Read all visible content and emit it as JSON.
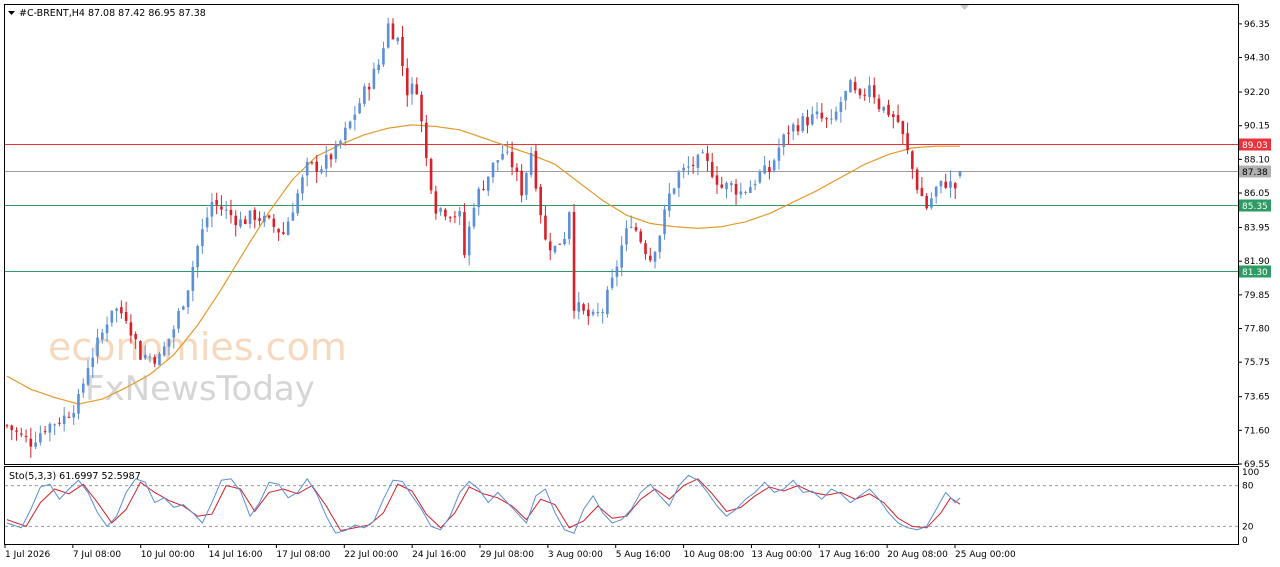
{
  "chart_data": {
    "type": "candlestick",
    "header": "#C-BRENT,H4  87.08 87.42 86.95 87.38",
    "symbol": "#C-BRENT",
    "timeframe": "H4",
    "ohlc": {
      "open": 87.08,
      "high": 87.42,
      "low": 86.95,
      "close": 87.38
    },
    "y_ticks": [
      "96.35",
      "94.30",
      "92.20",
      "90.15",
      "88.10",
      "86.05",
      "83.95",
      "81.90",
      "79.85",
      "77.80",
      "75.75",
      "73.65",
      "71.60",
      "69.55"
    ],
    "ylim": [
      69.55,
      97.5
    ],
    "x_ticks": [
      "1 Jul 2026",
      "7 Jul 08:00",
      "10 Jul 00:00",
      "14 Jul 16:00",
      "17 Jul 08:00",
      "22 Jul 00:00",
      "24 Jul 16:00",
      "29 Jul 08:00",
      "3 Aug 00:00",
      "5 Aug 16:00",
      "10 Aug 08:00",
      "13 Aug 00:00",
      "17 Aug 16:00",
      "20 Aug 08:00",
      "25 Aug 00:00"
    ],
    "price_anchors": [
      [
        0,
        71.9
      ],
      [
        3,
        71.2
      ],
      [
        5,
        70.9
      ],
      [
        8,
        71.8
      ],
      [
        12,
        72.4
      ],
      [
        15,
        73.4
      ],
      [
        17,
        75.6
      ],
      [
        20,
        77.5
      ],
      [
        22,
        79.1
      ],
      [
        25,
        78.6
      ],
      [
        28,
        76.2
      ],
      [
        32,
        76.0
      ],
      [
        35,
        77.8
      ],
      [
        38,
        80.4
      ],
      [
        40,
        82.8
      ],
      [
        43,
        85.5
      ],
      [
        46,
        84.9
      ],
      [
        49,
        84.3
      ],
      [
        52,
        84.7
      ],
      [
        55,
        84.2
      ],
      [
        58,
        83.6
      ],
      [
        60,
        85.2
      ],
      [
        63,
        87.6
      ],
      [
        66,
        87.7
      ],
      [
        69,
        88.6
      ],
      [
        72,
        90.3
      ],
      [
        75,
        92.2
      ],
      [
        78,
        93.9
      ],
      [
        80,
        96.3
      ],
      [
        82,
        95.4
      ],
      [
        84,
        92.3
      ],
      [
        86,
        92.5
      ],
      [
        88,
        88.1
      ],
      [
        90,
        85.2
      ],
      [
        93,
        84.9
      ],
      [
        95,
        84.6
      ],
      [
        96,
        82.3
      ],
      [
        98,
        85.5
      ],
      [
        100,
        86.6
      ],
      [
        102,
        87.7
      ],
      [
        104,
        88.5
      ],
      [
        106,
        87.8
      ],
      [
        108,
        86.2
      ],
      [
        110,
        88.6
      ],
      [
        113,
        83.1
      ],
      [
        115,
        82.7
      ],
      [
        117,
        83.5
      ],
      [
        118,
        85.1
      ],
      [
        119,
        79.3
      ],
      [
        121,
        78.7
      ],
      [
        123,
        78.4
      ],
      [
        125,
        78.9
      ],
      [
        127,
        80.6
      ],
      [
        129,
        82.8
      ],
      [
        131,
        84.4
      ],
      [
        133,
        83.2
      ],
      [
        135,
        82.1
      ],
      [
        137,
        83.6
      ],
      [
        139,
        85.9
      ],
      [
        141,
        87.2
      ],
      [
        144,
        87.8
      ],
      [
        146,
        88.1
      ],
      [
        148,
        87.4
      ],
      [
        150,
        86.4
      ],
      [
        152,
        86.5
      ],
      [
        154,
        86.1
      ],
      [
        156,
        86.5
      ],
      [
        158,
        87.2
      ],
      [
        160,
        87.4
      ],
      [
        162,
        88.8
      ],
      [
        164,
        89.9
      ],
      [
        167,
        90.4
      ],
      [
        170,
        90.7
      ],
      [
        173,
        90.2
      ],
      [
        175,
        91.6
      ],
      [
        177,
        92.5
      ],
      [
        179,
        91.6
      ],
      [
        181,
        92.8
      ],
      [
        183,
        91.4
      ],
      [
        185,
        91.0
      ],
      [
        187,
        90.4
      ],
      [
        189,
        88.5
      ],
      [
        191,
        86.5
      ],
      [
        193,
        85.2
      ],
      [
        195,
        86.3
      ],
      [
        197,
        86.7
      ],
      [
        199,
        86.4
      ],
      [
        200,
        87.38
      ]
    ],
    "ma_anchors": [
      [
        0,
        74.9
      ],
      [
        5,
        74.1
      ],
      [
        10,
        73.6
      ],
      [
        15,
        73.2
      ],
      [
        20,
        73.5
      ],
      [
        25,
        74.2
      ],
      [
        30,
        75.0
      ],
      [
        35,
        76.2
      ],
      [
        40,
        78.0
      ],
      [
        45,
        80.2
      ],
      [
        50,
        82.6
      ],
      [
        55,
        84.9
      ],
      [
        60,
        86.9
      ],
      [
        65,
        88.3
      ],
      [
        70,
        89.0
      ],
      [
        75,
        89.6
      ],
      [
        80,
        90.0
      ],
      [
        85,
        90.2
      ],
      [
        90,
        90.1
      ],
      [
        95,
        89.9
      ],
      [
        100,
        89.4
      ],
      [
        105,
        88.9
      ],
      [
        110,
        88.4
      ],
      [
        115,
        87.8
      ],
      [
        120,
        86.7
      ],
      [
        125,
        85.6
      ],
      [
        130,
        84.7
      ],
      [
        135,
        84.2
      ],
      [
        140,
        84.0
      ],
      [
        145,
        83.9
      ],
      [
        150,
        84.0
      ],
      [
        155,
        84.3
      ],
      [
        160,
        84.8
      ],
      [
        165,
        85.5
      ],
      [
        170,
        86.2
      ],
      [
        175,
        87.0
      ],
      [
        180,
        87.8
      ],
      [
        185,
        88.4
      ],
      [
        190,
        88.8
      ],
      [
        195,
        88.9
      ],
      [
        200,
        88.9
      ]
    ],
    "levels": [
      {
        "value": 89.03,
        "label": "89.03",
        "color": "#e8333b"
      },
      {
        "value": 87.38,
        "label": "87.38",
        "color": "#9e9e9e",
        "current": true
      },
      {
        "value": 85.35,
        "label": "85.35",
        "color": "#2e9b64"
      },
      {
        "value": 81.3,
        "label": "81.30",
        "color": "#2e9b64"
      }
    ],
    "colors": {
      "bull": "#5b8fd6",
      "bear": "#d7202a",
      "ma": "#e39a2b",
      "stoch_main": "#5b8fd6",
      "stoch_signal": "#cf1f2a"
    },
    "stochastic": {
      "label": "Sto(5,3,3) 61.6997 52.5987",
      "k": 61.6997,
      "d": 52.5987,
      "ticks": [
        "100",
        "80",
        "20",
        "0"
      ],
      "levels": [
        80,
        20
      ],
      "k_anchors": [
        [
          0,
          25
        ],
        [
          3,
          18
        ],
        [
          5,
          45
        ],
        [
          7,
          78
        ],
        [
          9,
          82
        ],
        [
          11,
          60
        ],
        [
          13,
          75
        ],
        [
          15,
          88
        ],
        [
          17,
          70
        ],
        [
          19,
          40
        ],
        [
          21,
          20
        ],
        [
          23,
          35
        ],
        [
          25,
          70
        ],
        [
          27,
          90
        ],
        [
          29,
          85
        ],
        [
          31,
          55
        ],
        [
          33,
          62
        ],
        [
          35,
          48
        ],
        [
          37,
          52
        ],
        [
          39,
          40
        ],
        [
          41,
          25
        ],
        [
          43,
          55
        ],
        [
          45,
          88
        ],
        [
          47,
          90
        ],
        [
          49,
          72
        ],
        [
          51,
          35
        ],
        [
          53,
          55
        ],
        [
          55,
          85
        ],
        [
          57,
          82
        ],
        [
          59,
          62
        ],
        [
          61,
          70
        ],
        [
          63,
          90
        ],
        [
          65,
          68
        ],
        [
          67,
          35
        ],
        [
          69,
          10
        ],
        [
          71,
          14
        ],
        [
          73,
          22
        ],
        [
          75,
          18
        ],
        [
          77,
          28
        ],
        [
          79,
          60
        ],
        [
          81,
          88
        ],
        [
          83,
          86
        ],
        [
          85,
          65
        ],
        [
          87,
          45
        ],
        [
          89,
          20
        ],
        [
          91,
          15
        ],
        [
          93,
          35
        ],
        [
          95,
          70
        ],
        [
          97,
          86
        ],
        [
          99,
          75
        ],
        [
          101,
          55
        ],
        [
          103,
          70
        ],
        [
          105,
          55
        ],
        [
          107,
          40
        ],
        [
          109,
          25
        ],
        [
          111,
          65
        ],
        [
          113,
          75
        ],
        [
          115,
          40
        ],
        [
          117,
          15
        ],
        [
          119,
          10
        ],
        [
          121,
          45
        ],
        [
          123,
          65
        ],
        [
          125,
          40
        ],
        [
          127,
          25
        ],
        [
          129,
          30
        ],
        [
          131,
          45
        ],
        [
          133,
          70
        ],
        [
          135,
          82
        ],
        [
          137,
          65
        ],
        [
          139,
          50
        ],
        [
          141,
          80
        ],
        [
          143,
          95
        ],
        [
          145,
          88
        ],
        [
          147,
          70
        ],
        [
          149,
          50
        ],
        [
          151,
          35
        ],
        [
          153,
          45
        ],
        [
          155,
          60
        ],
        [
          157,
          70
        ],
        [
          159,
          85
        ],
        [
          161,
          70
        ],
        [
          163,
          75
        ],
        [
          165,
          88
        ],
        [
          167,
          70
        ],
        [
          169,
          72
        ],
        [
          171,
          60
        ],
        [
          173,
          75
        ],
        [
          175,
          68
        ],
        [
          177,
          55
        ],
        [
          179,
          65
        ],
        [
          181,
          75
        ],
        [
          183,
          60
        ],
        [
          185,
          40
        ],
        [
          187,
          25
        ],
        [
          189,
          18
        ],
        [
          191,
          15
        ],
        [
          193,
          20
        ],
        [
          195,
          45
        ],
        [
          197,
          70
        ],
        [
          199,
          55
        ],
        [
          200,
          61.7
        ]
      ],
      "d_anchors": [
        [
          0,
          30
        ],
        [
          4,
          20
        ],
        [
          7,
          55
        ],
        [
          10,
          75
        ],
        [
          13,
          68
        ],
        [
          16,
          82
        ],
        [
          19,
          55
        ],
        [
          22,
          25
        ],
        [
          25,
          45
        ],
        [
          28,
          85
        ],
        [
          31,
          70
        ],
        [
          34,
          58
        ],
        [
          37,
          50
        ],
        [
          40,
          35
        ],
        [
          43,
          38
        ],
        [
          46,
          80
        ],
        [
          49,
          75
        ],
        [
          52,
          42
        ],
        [
          55,
          70
        ],
        [
          58,
          75
        ],
        [
          61,
          68
        ],
        [
          64,
          80
        ],
        [
          67,
          50
        ],
        [
          70,
          14
        ],
        [
          73,
          18
        ],
        [
          76,
          22
        ],
        [
          79,
          40
        ],
        [
          82,
          82
        ],
        [
          85,
          72
        ],
        [
          88,
          38
        ],
        [
          91,
          18
        ],
        [
          94,
          40
        ],
        [
          97,
          78
        ],
        [
          100,
          68
        ],
        [
          103,
          62
        ],
        [
          106,
          50
        ],
        [
          109,
          30
        ],
        [
          112,
          60
        ],
        [
          115,
          52
        ],
        [
          118,
          18
        ],
        [
          121,
          28
        ],
        [
          124,
          50
        ],
        [
          127,
          32
        ],
        [
          130,
          35
        ],
        [
          133,
          60
        ],
        [
          136,
          75
        ],
        [
          139,
          60
        ],
        [
          142,
          80
        ],
        [
          145,
          90
        ],
        [
          148,
          68
        ],
        [
          151,
          42
        ],
        [
          154,
          48
        ],
        [
          157,
          65
        ],
        [
          160,
          78
        ],
        [
          163,
          72
        ],
        [
          166,
          80
        ],
        [
          169,
          70
        ],
        [
          172,
          66
        ],
        [
          175,
          70
        ],
        [
          178,
          60
        ],
        [
          181,
          68
        ],
        [
          184,
          55
        ],
        [
          187,
          32
        ],
        [
          190,
          20
        ],
        [
          193,
          18
        ],
        [
          196,
          40
        ],
        [
          198,
          62
        ],
        [
          200,
          52.6
        ]
      ]
    },
    "watermark": [
      "economies.com",
      "FxNewsToday"
    ]
  }
}
